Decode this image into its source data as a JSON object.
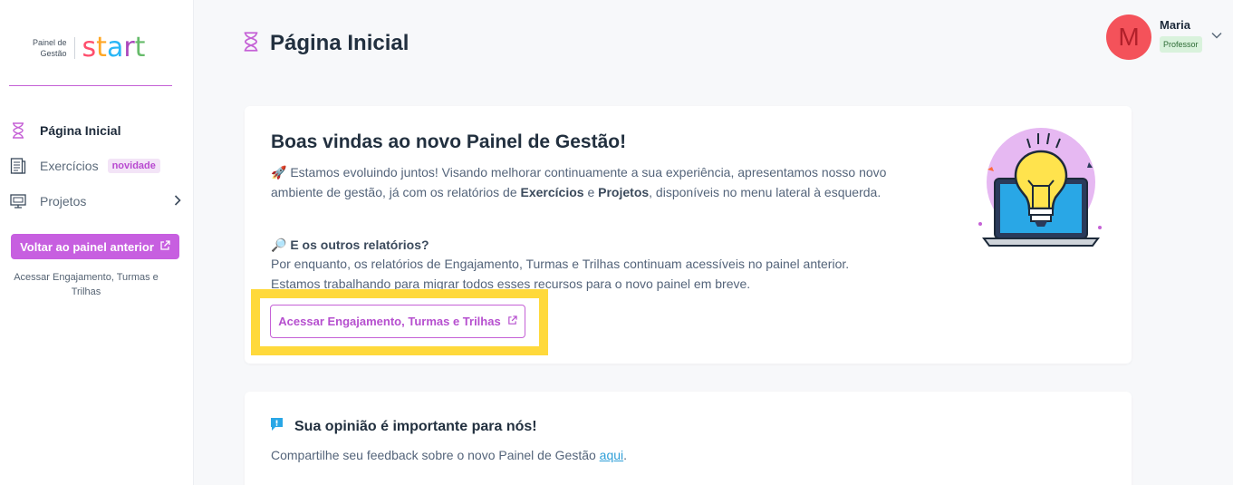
{
  "sidebar": {
    "logo_small_line1": "Painel de",
    "logo_small_line2": "Gestão",
    "logo_letters": [
      "s",
      "t",
      "a",
      "r",
      "t"
    ],
    "items": [
      {
        "label": "Página Inicial",
        "icon": "hourglass-icon",
        "active": true
      },
      {
        "label": "Exercícios",
        "icon": "document-icon",
        "badge": "novidade"
      },
      {
        "label": "Projetos",
        "icon": "monitor-icon",
        "has_submenu": true
      }
    ],
    "back_button_label": "Voltar ao painel anterior",
    "back_note": "Acessar Engajamento, Turmas e Trilhas"
  },
  "header": {
    "title": "Página Inicial",
    "icon": "hourglass-icon"
  },
  "user": {
    "initial": "M",
    "name": "Maria",
    "role": "Professor"
  },
  "welcome": {
    "title": "Boas vindas ao novo Painel de Gestão!",
    "rocket_emoji": "🚀",
    "text_part1": "Estamos evoluindo juntos! Visando melhorar continuamente a sua experiência, apresentamos nosso novo ambiente de gestão, já com os relatórios de ",
    "bold1": "Exercícios",
    "text_part2": " e ",
    "bold2": "Projetos",
    "text_part3": ", disponíveis no menu lateral à esquerda.",
    "key_emoji": "🔎",
    "sub_title": "E os outros relatórios?",
    "sub_text": "Por enquanto, os relatórios de Engajamento, Turmas e Trilhas continuam acessíveis no painel anterior. Estamos trabalhando para migrar todos esses recursos para o novo painel em breve.",
    "link_button_label": "Acessar Engajamento, Turmas e Trilhas"
  },
  "feedback": {
    "title": "Sua opinião é importante para nós!",
    "text": "Compartilhe seu feedback sobre o novo Painel de Gestão ",
    "link_label": "aqui",
    "text_end": "."
  },
  "colors": {
    "accent": "#c75fe0",
    "highlight": "#ffd93b",
    "avatar": "#f4525a",
    "role_badge": "#d9f2dc"
  }
}
